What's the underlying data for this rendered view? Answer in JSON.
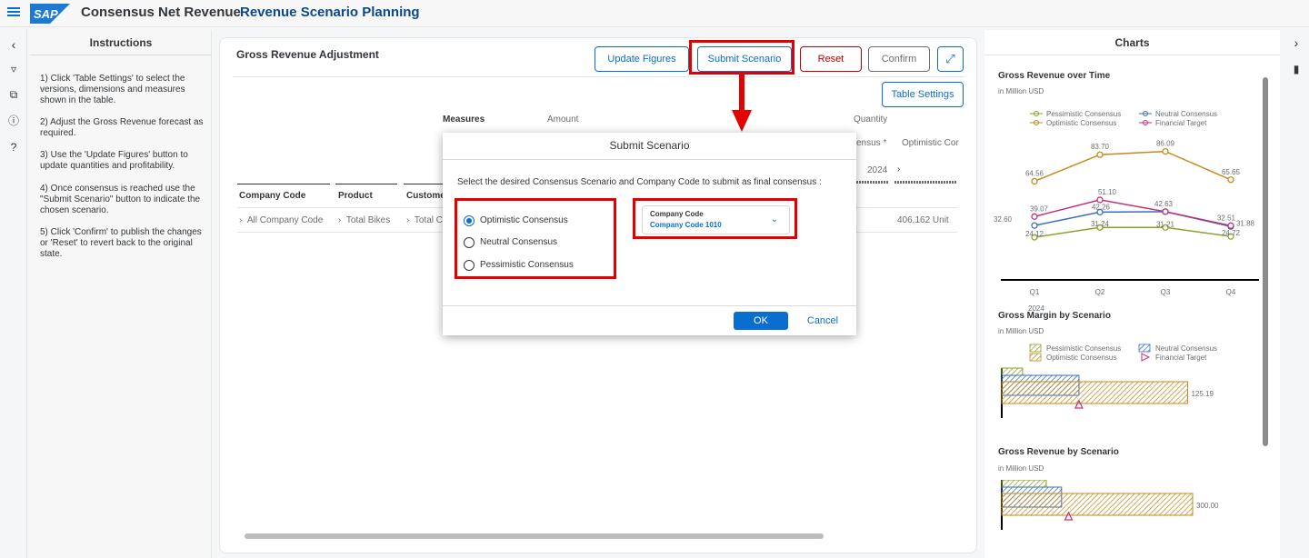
{
  "header": {
    "logo_text": "SAP",
    "app_title": "Consensus Net Revenue",
    "page_title": "Revenue Scenario Planning"
  },
  "instructions": {
    "title": "Instructions",
    "steps": [
      "1) Click 'Table Settings' to select the versions, dimensions and measures shown in the table.",
      "2) Adjust the Gross Revenue forecast as required.",
      "3) Use the 'Update Figures' button to update quantities and profitability.",
      "4) Once consensus is reached use the \"Submit Scenario\" button to indicate the chosen scenario.",
      "5) Click 'Confirm' to publish the changes or 'Reset' to revert back to the original state."
    ]
  },
  "main": {
    "title": "Gross Revenue Adjustment",
    "buttons": {
      "update": "Update Figures",
      "submit": "Submit Scenario",
      "reset": "Reset",
      "confirm": "Confirm",
      "table_settings": "Table Settings"
    },
    "table": {
      "measures_label": "Measures",
      "amount_label": "Amount",
      "quantity_label": "Quantity",
      "col_partial_1": "ensus *",
      "col_partial_2": "Optimistic Cor",
      "year": "2024",
      "headers": [
        "Company Code",
        "Product",
        "Custome"
      ],
      "row": [
        "All Company Code",
        "Total Bikes",
        "Total C"
      ],
      "row_value": "406,162 Unit"
    }
  },
  "dialog": {
    "title": "Submit Scenario",
    "message": "Select the desired Consensus Scenario and Company Code to submit as final consensus :",
    "options": [
      "Optimistic Consensus",
      "Neutral Consensus",
      "Pessimistic Consensus"
    ],
    "selected_option": "Optimistic Consensus",
    "company_code": {
      "label": "Company Code",
      "value": "Company Code 1010"
    },
    "ok": "OK",
    "cancel": "Cancel"
  },
  "charts_panel": {
    "title": "Charts",
    "chart1_title": "Gross Revenue over Time",
    "chart1_sub": "in Million USD",
    "chart2_title": "Gross Margin by Scenario",
    "chart2_sub": "in Million USD",
    "chart3_title": "Gross Revenue by Scenario",
    "chart3_sub": "in Million USD"
  },
  "colors": {
    "accent": "#0a6ed1",
    "highlight": "#e30000",
    "pessimistic": "#8fa02a",
    "neutral": "#3a6fb5",
    "optimistic": "#c58a1d",
    "target": "#c0317a"
  },
  "chart_data": [
    {
      "type": "line",
      "title": "Gross Revenue over Time",
      "subtitle": "in Million USD",
      "categories": [
        "Q1",
        "Q2",
        "Q3",
        "Q4"
      ],
      "x_year_label": "2024",
      "legend": "top",
      "series": [
        {
          "name": "Pessimistic Consensus",
          "values": [
            24.12,
            31.24,
            31.21,
            24.72
          ]
        },
        {
          "name": "Neutral Consensus",
          "values": [
            32.6,
            42.26,
            42.63,
            31.88
          ]
        },
        {
          "name": "Optimistic Consensus",
          "values": [
            64.56,
            83.7,
            86.09,
            65.65
          ]
        },
        {
          "name": "Financial Target",
          "values": [
            39.07,
            51.1,
            42.63,
            32.51
          ]
        }
      ],
      "data_labels": [
        "64.56",
        "83.70",
        "86.09",
        "65.65",
        "32.60",
        "39.07",
        "42.26",
        "51.10",
        "42.63",
        "32.51",
        "31.88",
        "24.12",
        "31.24",
        "31.21",
        "24.72"
      ]
    },
    {
      "type": "bar",
      "title": "Gross Margin by Scenario",
      "subtitle": "in Million USD",
      "orientation": "horizontal",
      "legend": "top",
      "series": [
        {
          "name": "Pessimistic Consensus",
          "values": [
            14
          ]
        },
        {
          "name": "Neutral Consensus",
          "values": [
            52
          ]
        },
        {
          "name": "Optimistic Consensus",
          "values": [
            125.19
          ]
        },
        {
          "name": "Financial Target",
          "values": [
            52
          ]
        }
      ],
      "data_labels": [
        "125.19"
      ],
      "xlim": [
        0,
        150
      ]
    },
    {
      "type": "bar",
      "title": "Gross Revenue by Scenario",
      "subtitle": "in Million USD",
      "orientation": "horizontal",
      "series": [
        {
          "name": "Pessimistic Consensus",
          "values": [
            70
          ]
        },
        {
          "name": "Neutral Consensus",
          "values": [
            94
          ]
        },
        {
          "name": "Optimistic Consensus",
          "values": [
            300.0
          ]
        },
        {
          "name": "Financial Target",
          "values": [
            105
          ]
        }
      ],
      "data_labels": [
        "300.00"
      ],
      "xlim": [
        0,
        350
      ]
    }
  ]
}
